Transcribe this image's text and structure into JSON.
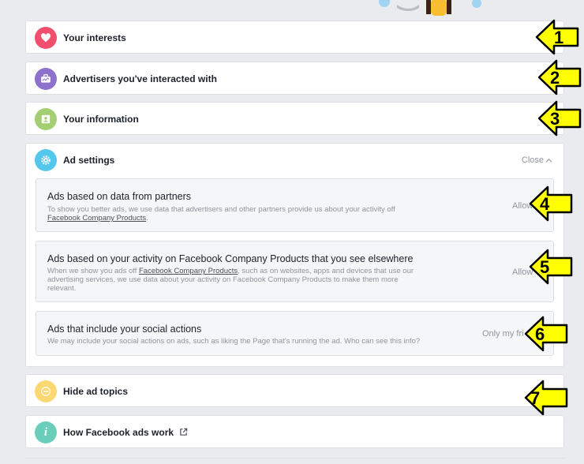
{
  "rows": {
    "interests": {
      "title": "Your interests",
      "color": "#f0506e"
    },
    "advertisers": {
      "title": "Advertisers you've interacted with",
      "color": "#8c72cb"
    },
    "information": {
      "title": "Your information",
      "color": "#a3ce71"
    },
    "ad_settings": {
      "title": "Ad settings",
      "color": "#54c7ec",
      "close_label": "Close"
    },
    "hide_topics": {
      "title": "Hide ad topics",
      "color": "#fcd872"
    },
    "how_ads_work": {
      "title": "How Facebook ads work",
      "color": "#6bcebb"
    }
  },
  "settings": [
    {
      "title": "Ads based on data from partners",
      "desc_before": "To show you better ads, we use data that advertisers and other partners provide us about your activity off ",
      "desc_link": "Facebook Company Products",
      "desc_after": ".",
      "value": "Allow"
    },
    {
      "title": "Ads based on your activity on Facebook Company Products that you see elsewhere",
      "desc_line1_before": "When we show you ads off ",
      "desc_link": "Facebook Company Products",
      "desc_line1_after": ", such as on websites, apps and devices that use our",
      "desc_line2": "advertising services, we use data about your activity on Facebook Company Products to make them more",
      "desc_line3": "relevant.",
      "value": "Allow"
    },
    {
      "title": "Ads that include your social actions",
      "desc": "We may include your social actions on ads, such as liking the Page that's running the ad. Who can see this info?",
      "value": "Only my fri"
    }
  ],
  "annotations": [
    "1",
    "2",
    "3",
    "4",
    "5",
    "6",
    "7"
  ],
  "accent": {
    "arrow_fill": "#ffff00",
    "arrow_stroke": "#000000"
  }
}
